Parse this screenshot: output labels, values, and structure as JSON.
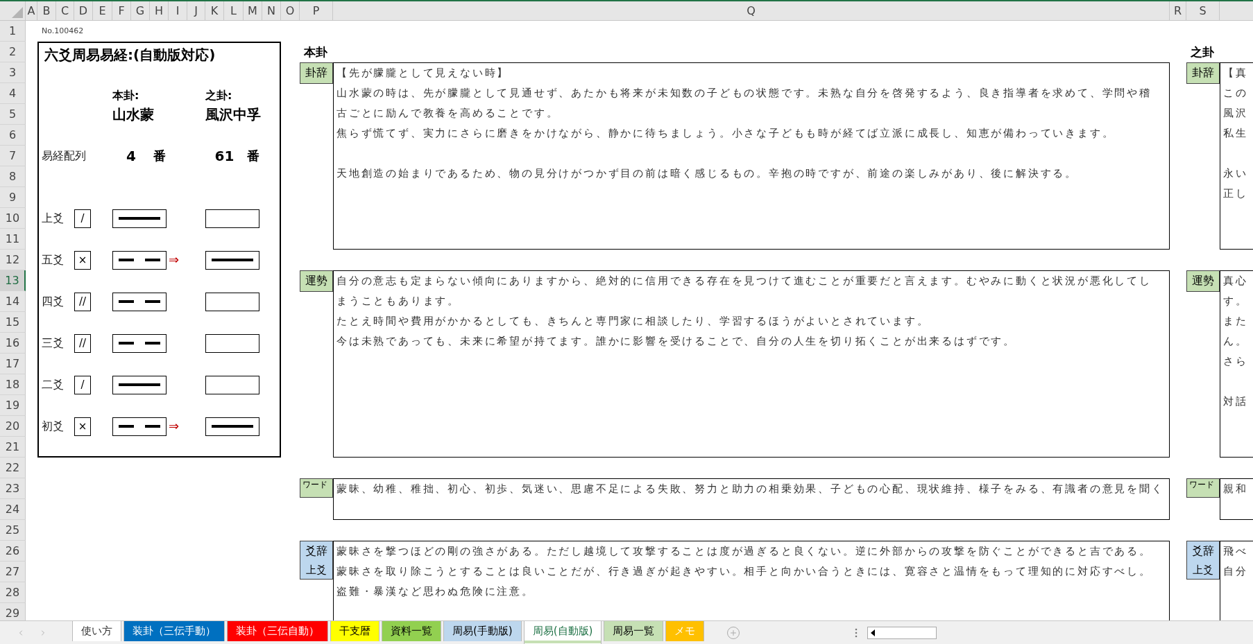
{
  "sheet": {
    "columns": [
      "A",
      "B",
      "C",
      "D",
      "E",
      "F",
      "G",
      "H",
      "I",
      "J",
      "K",
      "L",
      "M",
      "N",
      "O",
      "P",
      "Q",
      "R",
      "S"
    ],
    "rows": [
      {
        "label": "1",
        "selected": false
      },
      {
        "label": "2",
        "selected": false
      },
      {
        "label": "3",
        "selected": false
      },
      {
        "label": "4",
        "selected": false
      },
      {
        "label": "5",
        "selected": false
      },
      {
        "label": "6",
        "selected": false
      },
      {
        "label": "7",
        "selected": false
      },
      {
        "label": "8",
        "selected": false
      },
      {
        "label": "9",
        "selected": false
      },
      {
        "label": "10",
        "selected": false
      },
      {
        "label": "11",
        "selected": false
      },
      {
        "label": "12",
        "selected": false
      },
      {
        "label": "13",
        "selected": true
      },
      {
        "label": "14",
        "selected": false
      },
      {
        "label": "15",
        "selected": false
      },
      {
        "label": "16",
        "selected": false
      },
      {
        "label": "17",
        "selected": false
      },
      {
        "label": "18",
        "selected": false
      },
      {
        "label": "19",
        "selected": false
      },
      {
        "label": "20",
        "selected": false
      },
      {
        "label": "21",
        "selected": false
      },
      {
        "label": "22",
        "selected": false
      },
      {
        "label": "23",
        "selected": false
      },
      {
        "label": "24",
        "selected": false
      },
      {
        "label": "25",
        "selected": false
      },
      {
        "label": "26",
        "selected": false
      },
      {
        "label": "27",
        "selected": false
      },
      {
        "label": "28",
        "selected": false
      },
      {
        "label": "29",
        "selected": false
      }
    ],
    "serial": "No.100462",
    "panel": {
      "title": "六爻周易易経:(自動版対応)",
      "order_label": "易経配列",
      "primary": {
        "heading": "本卦:",
        "name": "山水蒙",
        "number": "4",
        "unit": "番"
      },
      "changed": {
        "heading": "之卦:",
        "name": "風沢中孚",
        "number": "61",
        "unit": "番"
      },
      "lines": [
        {
          "label": "上爻",
          "mark": "/",
          "kind": "yang"
        },
        {
          "label": "五爻",
          "mark": "×",
          "kind": "yin",
          "arrow": "⇒",
          "result": {
            "kind": "yang"
          }
        },
        {
          "label": "四爻",
          "mark": "//",
          "kind": "yin"
        },
        {
          "label": "三爻",
          "mark": "//",
          "kind": "yin"
        },
        {
          "label": "二爻",
          "mark": "/",
          "kind": "yang"
        },
        {
          "label": "初爻",
          "mark": "×",
          "kind": "yin",
          "arrow": "⇒",
          "result": {
            "kind": "yang"
          }
        }
      ]
    },
    "readings": [
      {
        "heading": "本卦",
        "sections": [
          {
            "kind": "hexagram",
            "label": "卦辞",
            "paragraphs": [
              {
                "text": "【先が朦朧として見えない時】"
              },
              {
                "text": "山水蒙の時は、先が朦朧として見通せず、あたかも将来が未知数の子どもの状態です。未熟な自分を啓発するよう、良き指導者を求めて、学問や稽古ごとに励んで教養を高めることです。"
              },
              {
                "text": "焦らず慌てず、実力にさらに磨きをかけながら、静かに待ちましょう。小さな子どもも時が経てば立派に成長し、知恵が備わっていきます。"
              },
              {
                "kind": "blank"
              },
              {
                "text": "天地創造の始まりであるため、物の見分けがつかず目の前は暗く感じるもの。辛抱の時ですが、前途の楽しみがあり、後に解決する。"
              }
            ]
          },
          {
            "kind": "fortune",
            "label": "運勢",
            "paragraphs": [
              {
                "text": "自分の意志も定まらない傾向にありますから、絶対的に信用できる存在を見つけて進むことが重要だと言えます。むやみに動くと状況が悪化してしまうこともあります。"
              },
              {
                "text": "たとえ時間や費用がかかるとしても、きちんと専門家に相談したり、学習するほうがよいとされています。"
              },
              {
                "text": "今は未熟であっても、未来に希望が持てます。誰かに影響を受けることで、自分の人生を切り拓くことが出来るはずです。"
              }
            ]
          },
          {
            "kind": "words",
            "label": "ワード",
            "paragraphs": [
              {
                "text": "蒙昧、幼稚、稚拙、初心、初歩、気迷い、思慮不足による失敗、努力と助力の相乗効果、子どもの心配、現状維持、様子をみる、有識者の意見を聞く"
              }
            ]
          },
          {
            "kind": "line",
            "label": "爻辞",
            "sub_label": "上爻",
            "paragraphs": [
              {
                "text": "蒙昧さを撃つほどの剛の強さがある。ただし越境して攻撃することは度が過ぎると良くない。逆に外部からの攻撃を防ぐことができると吉である。"
              },
              {
                "text": "蒙昧さを取り除こうとすることは良いことだが、行き過ぎが起きやすい。相手と向かい合うときには、寛容さと温情をもって理知的に対応すべし。"
              },
              {
                "text": "盗難・暴漢など思わぬ危険に注意。"
              }
            ]
          }
        ]
      },
      {
        "heading": "之卦",
        "sections": [
          {
            "kind": "hexagram",
            "label": "卦辞",
            "paragraphs": [
              {
                "text": "【真"
              },
              {
                "text": "この"
              },
              {
                "text": "風沢"
              },
              {
                "text": "私生"
              },
              {
                "kind": "blank"
              },
              {
                "text": "永い"
              },
              {
                "text": "正し"
              }
            ]
          },
          {
            "kind": "fortune",
            "label": "運勢",
            "paragraphs": [
              {
                "text": "真心"
              },
              {
                "text": "す。"
              },
              {
                "text": "また"
              },
              {
                "text": "ん。"
              },
              {
                "text": "さら"
              },
              {
                "kind": "blank"
              },
              {
                "text": "対話"
              }
            ]
          },
          {
            "kind": "words",
            "label": "ワード",
            "paragraphs": [
              {
                "text": "親和"
              }
            ]
          },
          {
            "kind": "line",
            "label": "爻辞",
            "sub_label": "上爻",
            "paragraphs": [
              {
                "text": "飛べ"
              },
              {
                "text": "自分"
              }
            ]
          }
        ]
      }
    ]
  },
  "sheet_tabs": [
    {
      "label": "使い方",
      "selected": false
    },
    {
      "label": "装卦（三伝手動）",
      "selected": false,
      "color": "#0070c0"
    },
    {
      "label": "装卦（三伝自動）",
      "selected": false,
      "color": "#ff0000"
    },
    {
      "label": "干支暦",
      "selected": false,
      "color": "#ffff00"
    },
    {
      "label": "資料一覧",
      "selected": false,
      "color": "#92d050"
    },
    {
      "label": "周易(手動版)",
      "selected": false,
      "color": "#bdd7ee"
    },
    {
      "label": "周易(自動版)",
      "selected": true,
      "color": "#c6e0b4"
    },
    {
      "label": "周易一覧",
      "selected": false,
      "color": "#c6e0b4"
    },
    {
      "label": "メモ",
      "selected": false,
      "color": "#ffc000"
    }
  ]
}
